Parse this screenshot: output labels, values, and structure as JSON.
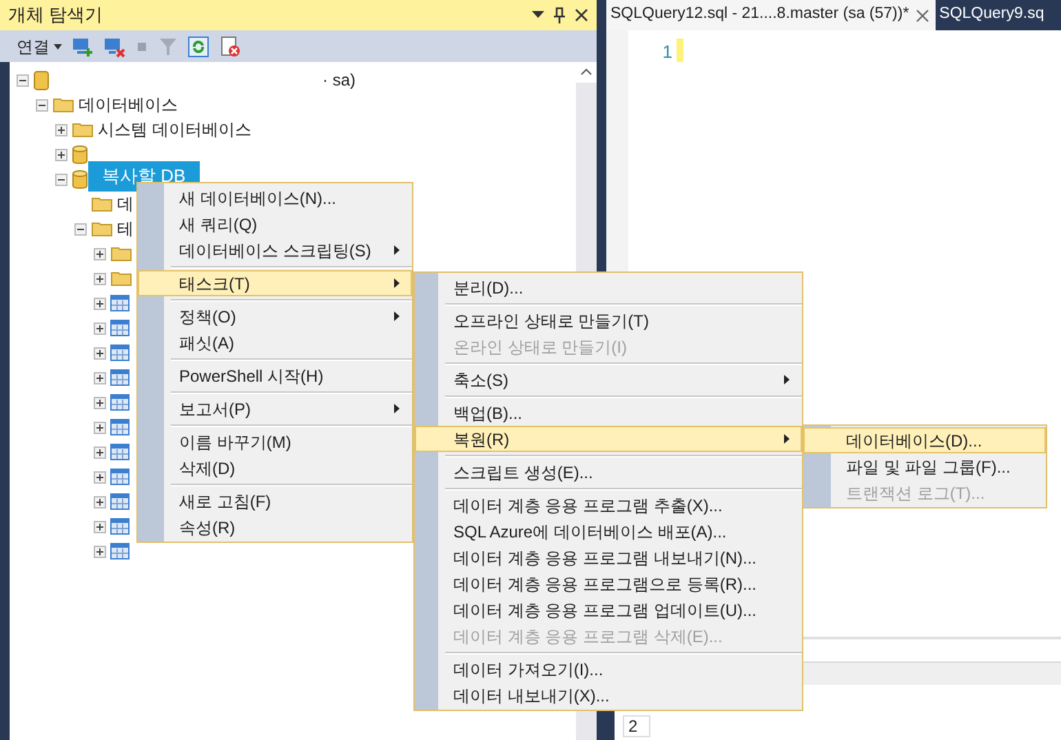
{
  "object_explorer": {
    "title": "개체 탐색기",
    "toolbar": {
      "connect_label": "연결"
    },
    "tree": [
      {
        "kind": "server",
        "expanded": true,
        "label": "· sa)",
        "children": [
          {
            "kind": "folder",
            "expanded": true,
            "label": "데이터베이스",
            "children": [
              {
                "kind": "folder",
                "expanded": false,
                "label": "시스템 데이터베이스"
              },
              {
                "kind": "database",
                "expanded": false
              },
              {
                "kind": "database",
                "expanded": true,
                "children": [
                  {
                    "kind": "folder",
                    "label": "데"
                  },
                  {
                    "kind": "folder",
                    "expanded": true,
                    "label": "테",
                    "children": [
                      {
                        "kind": "folder",
                        "expanded": false
                      },
                      {
                        "kind": "folder",
                        "expanded": false
                      },
                      {
                        "kind": "table",
                        "expanded": false
                      },
                      {
                        "kind": "table",
                        "expanded": false
                      },
                      {
                        "kind": "table",
                        "expanded": false
                      },
                      {
                        "kind": "table",
                        "expanded": false
                      },
                      {
                        "kind": "table",
                        "expanded": false
                      },
                      {
                        "kind": "table",
                        "expanded": false
                      },
                      {
                        "kind": "table",
                        "expanded": false
                      },
                      {
                        "kind": "table",
                        "expanded": false
                      },
                      {
                        "kind": "table",
                        "expanded": false
                      },
                      {
                        "kind": "table",
                        "expanded": false
                      },
                      {
                        "kind": "table",
                        "expanded": false
                      }
                    ]
                  }
                ]
              }
            ]
          }
        ]
      }
    ]
  },
  "callout": "복사할 DB",
  "editor": {
    "tabs": [
      {
        "label": "SQLQuery12.sql - 21....8.master (sa (57))*",
        "selected": true
      },
      {
        "label": "SQLQuery9.sq",
        "selected": false
      }
    ],
    "line_numbers": [
      "1"
    ],
    "results": {
      "row_numbers": [
        "2"
      ]
    }
  },
  "context_menu": [
    {
      "kind": "item",
      "label": "새 데이터베이스(N)...",
      "has_submenu": false,
      "selected": false,
      "disabled": false
    },
    {
      "kind": "item",
      "label": "새 쿼리(Q)",
      "has_submenu": false,
      "selected": false,
      "disabled": false
    },
    {
      "kind": "item",
      "label": "데이터베이스 스크립팅(S)",
      "has_submenu": true,
      "selected": false,
      "disabled": false
    },
    {
      "kind": "separator"
    },
    {
      "kind": "item",
      "label": "태스크(T)",
      "has_submenu": true,
      "selected": true,
      "disabled": false
    },
    {
      "kind": "separator"
    },
    {
      "kind": "item",
      "label": "정책(O)",
      "has_submenu": true,
      "selected": false,
      "disabled": false
    },
    {
      "kind": "item",
      "label": "패싯(A)",
      "has_submenu": false,
      "selected": false,
      "disabled": false
    },
    {
      "kind": "separator"
    },
    {
      "kind": "item",
      "label": "PowerShell 시작(H)",
      "has_submenu": false,
      "selected": false,
      "disabled": false
    },
    {
      "kind": "separator"
    },
    {
      "kind": "item",
      "label": "보고서(P)",
      "has_submenu": true,
      "selected": false,
      "disabled": false
    },
    {
      "kind": "separator"
    },
    {
      "kind": "item",
      "label": "이름 바꾸기(M)",
      "has_submenu": false,
      "selected": false,
      "disabled": false
    },
    {
      "kind": "item",
      "label": "삭제(D)",
      "has_submenu": false,
      "selected": false,
      "disabled": false
    },
    {
      "kind": "separator"
    },
    {
      "kind": "item",
      "label": "새로 고침(F)",
      "has_submenu": false,
      "selected": false,
      "disabled": false
    },
    {
      "kind": "item",
      "label": "속성(R)",
      "has_submenu": false,
      "selected": false,
      "disabled": false
    }
  ],
  "tasks_submenu": [
    {
      "kind": "item",
      "label": "분리(D)...",
      "has_submenu": false,
      "selected": false,
      "disabled": false
    },
    {
      "kind": "separator"
    },
    {
      "kind": "item",
      "label": "오프라인 상태로 만들기(T)",
      "has_submenu": false,
      "selected": false,
      "disabled": false
    },
    {
      "kind": "item",
      "label": "온라인 상태로 만들기(I)",
      "has_submenu": false,
      "selected": false,
      "disabled": true
    },
    {
      "kind": "separator"
    },
    {
      "kind": "item",
      "label": "축소(S)",
      "has_submenu": true,
      "selected": false,
      "disabled": false
    },
    {
      "kind": "separator"
    },
    {
      "kind": "item",
      "label": "백업(B)...",
      "has_submenu": false,
      "selected": false,
      "disabled": false
    },
    {
      "kind": "item",
      "label": "복원(R)",
      "has_submenu": true,
      "selected": true,
      "disabled": false
    },
    {
      "kind": "separator"
    },
    {
      "kind": "item",
      "label": "스크립트 생성(E)...",
      "has_submenu": false,
      "selected": false,
      "disabled": false
    },
    {
      "kind": "separator"
    },
    {
      "kind": "item",
      "label": "데이터 계층 응용 프로그램 추출(X)...",
      "has_submenu": false,
      "selected": false,
      "disabled": false
    },
    {
      "kind": "item",
      "label": "SQL Azure에 데이터베이스 배포(A)...",
      "has_submenu": false,
      "selected": false,
      "disabled": false
    },
    {
      "kind": "item",
      "label": "데이터 계층 응용 프로그램 내보내기(N)...",
      "has_submenu": false,
      "selected": false,
      "disabled": false
    },
    {
      "kind": "item",
      "label": "데이터 계층 응용 프로그램으로 등록(R)...",
      "has_submenu": false,
      "selected": false,
      "disabled": false
    },
    {
      "kind": "item",
      "label": "데이터 계층 응용 프로그램 업데이트(U)...",
      "has_submenu": false,
      "selected": false,
      "disabled": false
    },
    {
      "kind": "item",
      "label": "데이터 계층 응용 프로그램 삭제(E)...",
      "has_submenu": false,
      "selected": false,
      "disabled": true
    },
    {
      "kind": "separator"
    },
    {
      "kind": "item",
      "label": "데이터 가져오기(I)...",
      "has_submenu": false,
      "selected": false,
      "disabled": false
    },
    {
      "kind": "item",
      "label": "데이터 내보내기(X)...",
      "has_submenu": false,
      "selected": false,
      "disabled": false
    }
  ],
  "restore_submenu": [
    {
      "kind": "item",
      "label": "데이터베이스(D)...",
      "has_submenu": false,
      "selected": true,
      "disabled": false
    },
    {
      "kind": "item",
      "label": "파일 및 파일 그룹(F)...",
      "has_submenu": false,
      "selected": false,
      "disabled": false
    },
    {
      "kind": "item",
      "label": "트랜잭션 로그(T)...",
      "has_submenu": false,
      "selected": false,
      "disabled": true
    }
  ]
}
